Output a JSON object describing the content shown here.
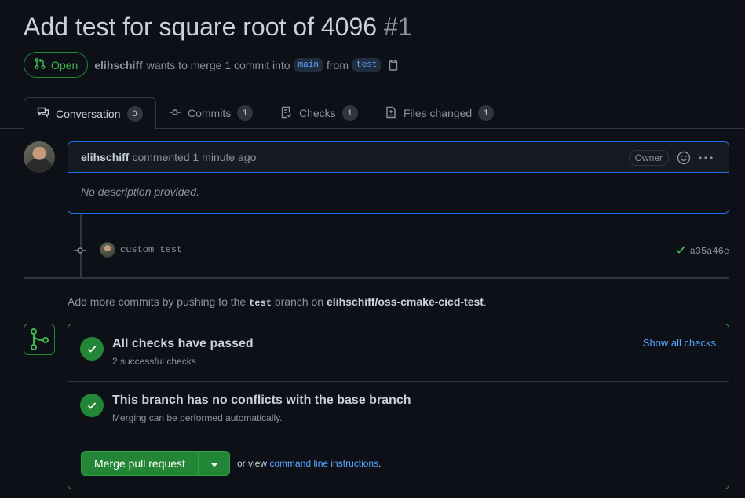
{
  "pr": {
    "title": "Add test for square root of 4096",
    "number": "#1",
    "state": "Open",
    "author": "elihschiff",
    "merge_text": "wants to merge 1 commit into",
    "base_branch": "main",
    "from_text": "from",
    "head_branch": "test"
  },
  "tabs": [
    {
      "label": "Conversation",
      "count": "0",
      "icon": "conversation-icon"
    },
    {
      "label": "Commits",
      "count": "1",
      "icon": "commit-icon"
    },
    {
      "label": "Checks",
      "count": "1",
      "icon": "checklist-icon"
    },
    {
      "label": "Files changed",
      "count": "1",
      "icon": "file-diff-icon"
    }
  ],
  "comment": {
    "author": "elihschiff",
    "meta": "commented 1 minute ago",
    "badge": "Owner",
    "body": "No description provided."
  },
  "commit": {
    "message": "custom test",
    "sha": "a35a46e"
  },
  "push_hint": {
    "prefix": "Add more commits by pushing to the",
    "branch": "test",
    "middle": "branch on",
    "repo": "elihschiff/oss-cmake-cicd-test",
    "suffix": "."
  },
  "merge": {
    "checks_title": "All checks have passed",
    "checks_sub": "2 successful checks",
    "show_checks": "Show all checks",
    "conflicts_title": "This branch has no conflicts with the base branch",
    "conflicts_sub": "Merging can be performed automatically.",
    "button": "Merge pull request",
    "alt_prefix": "or view",
    "alt_link": "command line instructions",
    "alt_suffix": "."
  },
  "colors": {
    "background": "#0d1117",
    "accent_green": "#238636",
    "link_blue": "#58a6ff",
    "muted": "#8b949e"
  }
}
